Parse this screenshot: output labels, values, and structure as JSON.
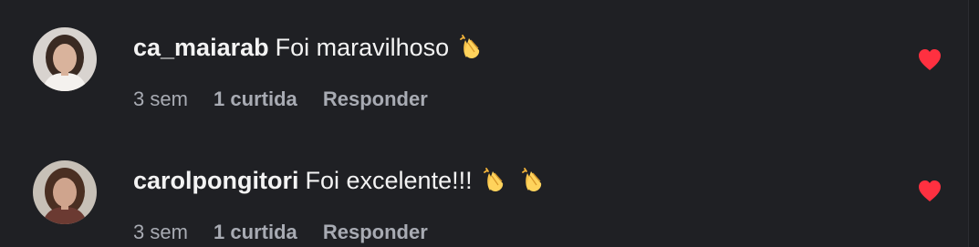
{
  "comments": [
    {
      "username": "ca_maiarab",
      "text": "Foi maravilhoso",
      "emojis": [
        "clapping-hands"
      ],
      "time": "3 sem",
      "likes": "1 curtida",
      "reply": "Responder",
      "liked": true,
      "heart_color": "#ff3040"
    },
    {
      "username": "carolpongitori",
      "text": "Foi excelente!!!",
      "emojis": [
        "clapping-hands",
        "clapping-hands"
      ],
      "time": "3 sem",
      "likes": "1 curtida",
      "reply": "Responder",
      "liked": true,
      "heart_color": "#ff3040"
    }
  ],
  "theme": {
    "background": "#1f2024",
    "text": "#f3f3f3",
    "muted": "#a8abb3"
  }
}
